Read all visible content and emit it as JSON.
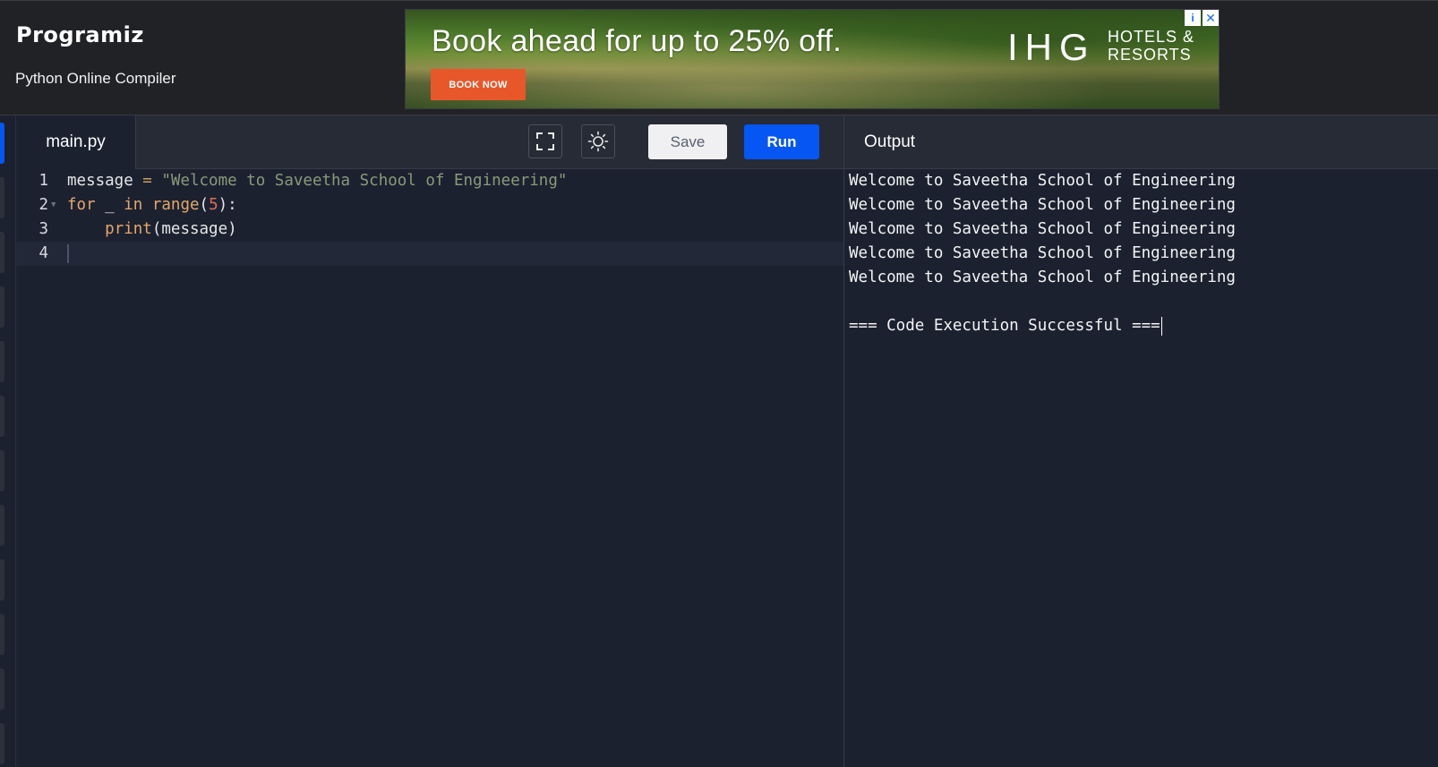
{
  "header": {
    "logo_text": "Programiz",
    "subtitle": "Python Online Compiler"
  },
  "ad": {
    "headline": "Book ahead for up to 25% off.",
    "button_label": "BOOK NOW",
    "brand": "IHG",
    "brand_sub_line1": "HOTELS &",
    "brand_sub_line2": "RESORTS",
    "info_glyph": "i",
    "close_glyph": "✕"
  },
  "editor": {
    "file_tab": "main.py",
    "toolbar": {
      "fullscreen_icon": "fullscreen-icon",
      "theme_icon": "sun-icon",
      "save_label": "Save",
      "run_label": "Run"
    },
    "lines": [
      {
        "number": "1",
        "tokens": {
          "t1": "message",
          "t2": " = ",
          "t3": "\"Welcome to Saveetha School of Engineering\""
        }
      },
      {
        "number": "2",
        "tokens": {
          "t1": "for",
          "t2": " _ ",
          "t3": "in",
          "t4": " ",
          "t5": "range",
          "t6": "(",
          "t7": "5",
          "t8": "):"
        }
      },
      {
        "number": "3",
        "tokens": {
          "t1": "    ",
          "t2": "print",
          "t3": "(message)"
        }
      },
      {
        "number": "4",
        "tokens": {}
      }
    ]
  },
  "output": {
    "title": "Output",
    "lines": [
      "Welcome to Saveetha School of Engineering",
      "Welcome to Saveetha School of Engineering",
      "Welcome to Saveetha School of Engineering",
      "Welcome to Saveetha School of Engineering",
      "Welcome to Saveetha School of Engineering",
      "",
      "=== Code Execution Successful ==="
    ]
  },
  "colors": {
    "accent": "#0556f3",
    "background": "#1c2130",
    "toolbar": "#272b36"
  }
}
